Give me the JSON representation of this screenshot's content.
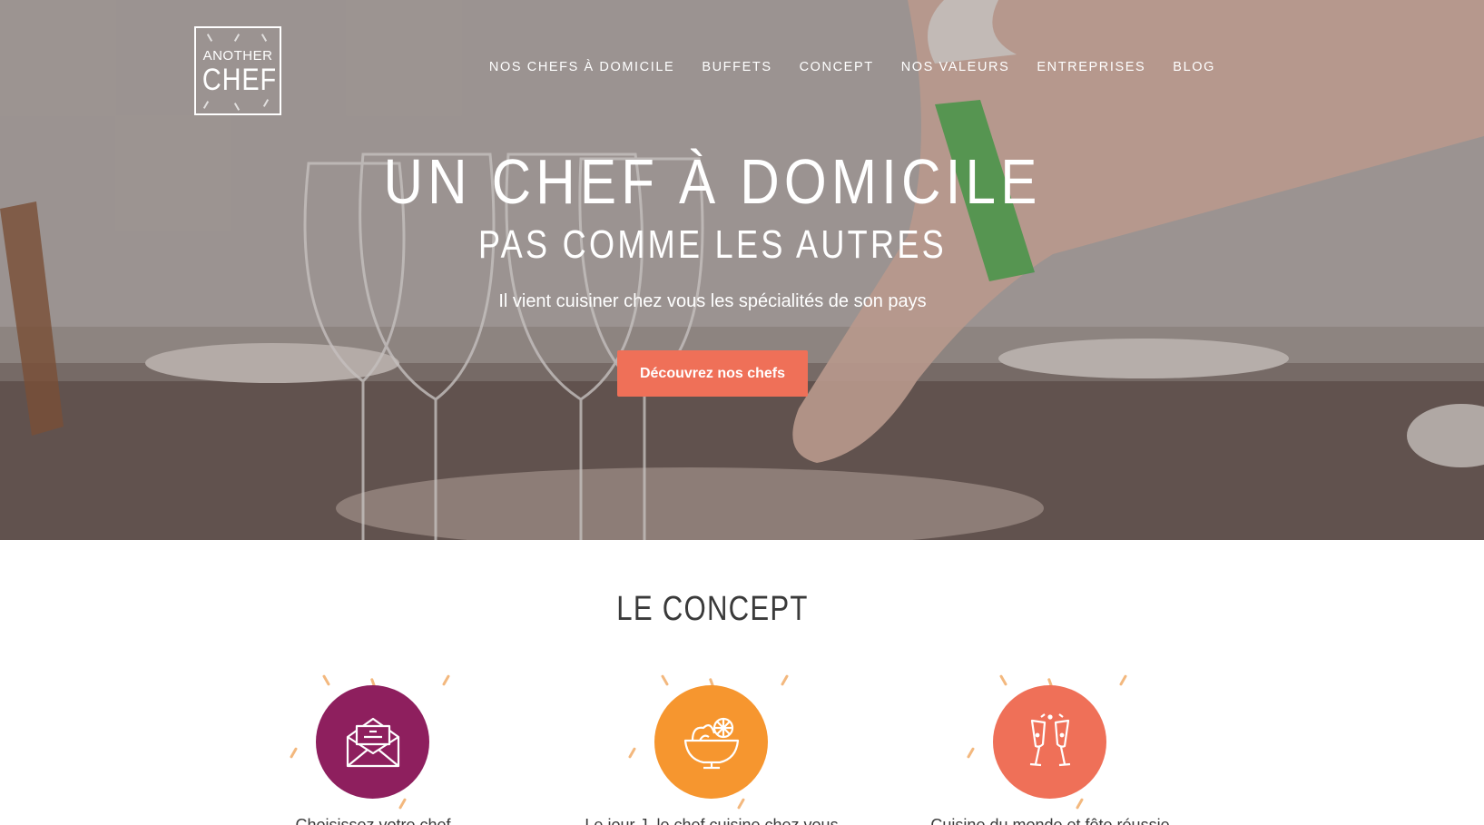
{
  "logo": {
    "top": "ANOTHER",
    "main": "CHEF"
  },
  "nav": [
    {
      "label": "NOS CHEFS À DOMICILE"
    },
    {
      "label": "BUFFETS"
    },
    {
      "label": "CONCEPT"
    },
    {
      "label": "NOS VALEURS"
    },
    {
      "label": "ENTREPRISES"
    },
    {
      "label": "BLOG"
    }
  ],
  "hero": {
    "title": "UN CHEF À DOMICILE",
    "subtitle": "PAS COMME LES AUTRES",
    "tagline": "Il vient cuisiner chez vous les spécialités de son pays",
    "cta": "Découvrez nos chefs"
  },
  "concept": {
    "title": "LE CONCEPT",
    "steps": [
      {
        "icon": "envelope-icon",
        "color": "#8e1f5e",
        "ray_color": "#f3b87e",
        "caption": "Choisissez votre chef"
      },
      {
        "icon": "salad-bowl-icon",
        "color": "#f6962f",
        "ray_color": "#f3b87e",
        "caption": "Le jour J, le chef cuisine chez vous"
      },
      {
        "icon": "champagne-icon",
        "color": "#ef7058",
        "ray_color": "#f3b87e",
        "caption": "Cuisine du monde et fête réussie"
      }
    ]
  },
  "colors": {
    "accent": "#ef7058",
    "purple": "#8e1f5e",
    "orange": "#f6962f"
  }
}
